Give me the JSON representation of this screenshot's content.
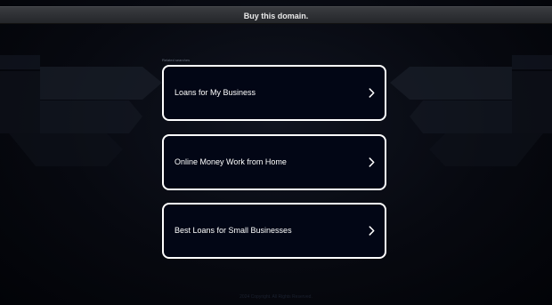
{
  "banner": {
    "label": "Buy this domain."
  },
  "related": {
    "heading": "Related searches",
    "items": [
      {
        "label": "Loans for My Business"
      },
      {
        "label": "Online Money Work from Home"
      },
      {
        "label": "Best Loans for Small Businesses"
      }
    ]
  },
  "footer": {
    "text": "2024 Copyright. All Rights Reserved."
  },
  "colors": {
    "background": "#05070d",
    "card_background": "#020615",
    "card_border": "#ffffff",
    "banner_background": "#2e3034"
  },
  "icons": {
    "card_action": "chevron-right-icon"
  }
}
